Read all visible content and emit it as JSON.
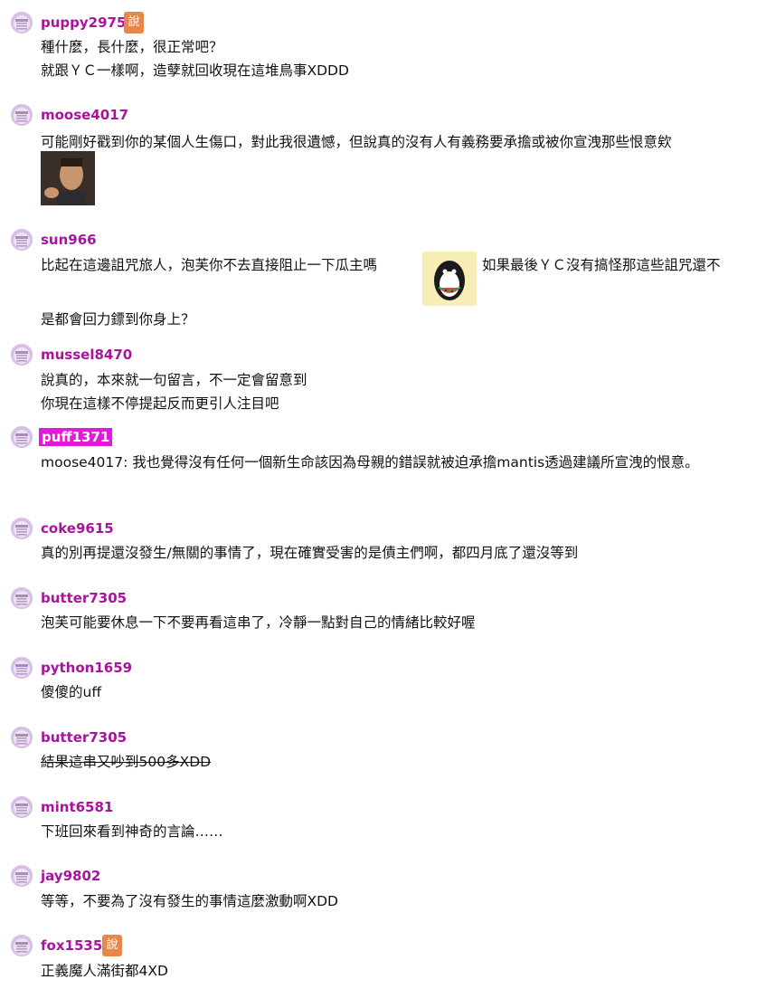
{
  "comments": [
    {
      "user": "puppy2975",
      "badge": "說",
      "lines": [
        "種什麼，長什麼，很正常吧？",
        "就跟ＹＣ一樣啊，造孽就回收現在這堆鳥事XDDD"
      ]
    },
    {
      "user": "moose4017",
      "lines": [
        "可能剛好戳到你的某個人生傷口，對此我很遺憾，但說真的沒有人有義務要承擔或被你宣洩那些恨意欸"
      ],
      "image": "face-photo"
    },
    {
      "user": "sun966",
      "text_before": "比起在這邊詛咒旅人，泡芙你不去直接阻止一下瓜主嗎",
      "text_after": "如果最後ＹＣ沒有搞怪那這些詛咒還不",
      "text_next": "是都會回力鏢到你身上？",
      "image": "penguin-watermelon-sticker"
    },
    {
      "user": "mussel8470",
      "lines": [
        "說真的，本來就一句留言，不一定會留意到",
        "你現在這樣不停提起反而更引人注目吧"
      ]
    },
    {
      "user": "puff1371",
      "lines": [
        "moose4017: 我也覺得沒有任何一個新生命該因為母親的錯誤就被迫承擔mantis透過建議所宣洩的恨意。"
      ]
    },
    {
      "user": "coke9615",
      "lines": [
        "真的別再提還沒發生/無關的事情了，現在確實受害的是債主們啊，都四月底了還沒等到"
      ]
    },
    {
      "user": "butter7305",
      "lines": [
        "泡芙可能要休息一下不要再看這串了，冷靜一點對自己的情緒比較好喔"
      ]
    },
    {
      "user": "python1659",
      "lines": [
        "傻傻的uff"
      ]
    },
    {
      "user": "butter7305",
      "lines": [
        "結果這串又吵到500多XDD"
      ]
    },
    {
      "user": "mint6581",
      "lines": [
        "下班回來看到神奇的言論……"
      ]
    },
    {
      "user": "jay9802",
      "lines": [
        "等等，不要為了沒有發生的事情這麼激動啊XDD"
      ]
    },
    {
      "user": "fox1535",
      "badge": "說",
      "lines": [
        "正義魔人滿街都4XD"
      ]
    }
  ],
  "colors": {
    "username": "#a8149b",
    "highlight_bg": "#e219d6",
    "badge_bg": "#e8874a"
  }
}
